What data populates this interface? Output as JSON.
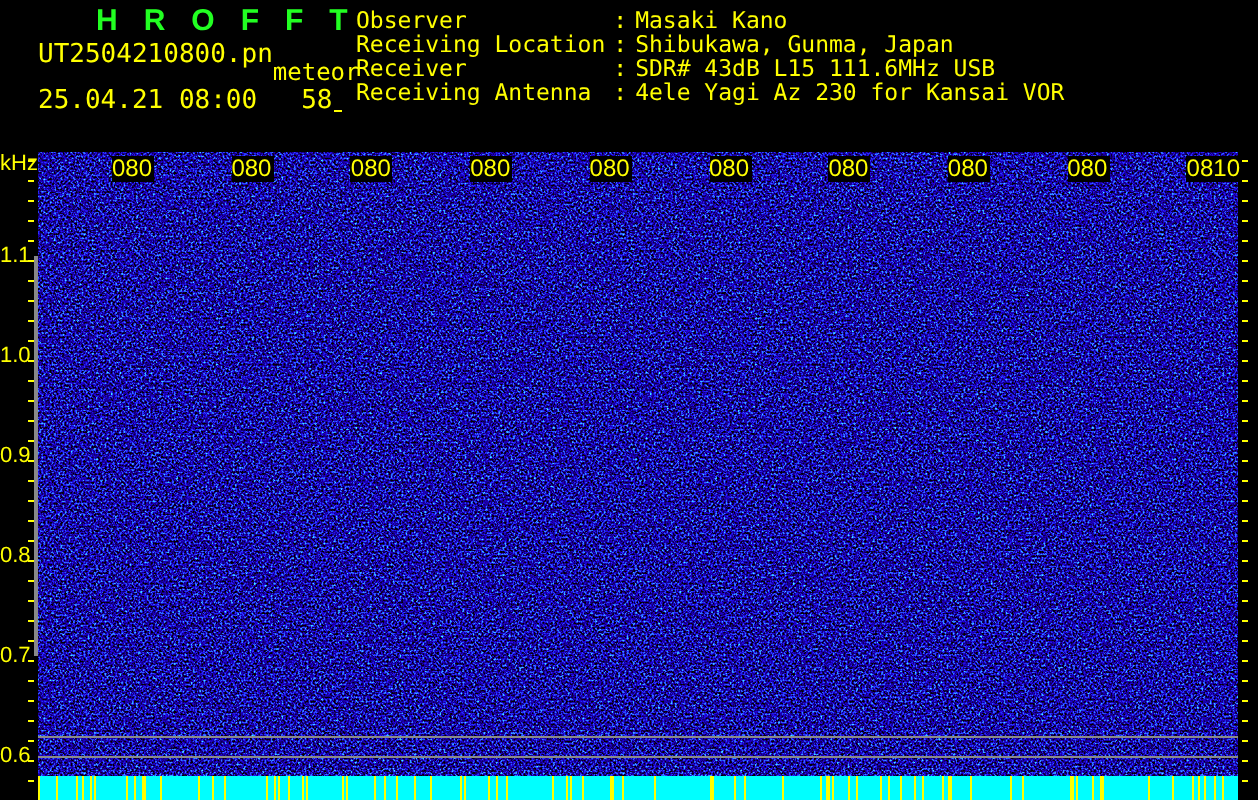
{
  "header": {
    "title": "HROFFT",
    "file_name": "UT2504210800.pn",
    "mode": "meteor",
    "timestamp": "25.04.21 08:00",
    "count": "58"
  },
  "info": [
    {
      "label": "Observer",
      "separator": ":",
      "value": "Masaki Kano"
    },
    {
      "label": "Receiving Location",
      "separator": ":",
      "value": "Shibukawa, Gunma, Japan"
    },
    {
      "label": "Receiver",
      "separator": ":",
      "value": "SDR# 43dB L15 111.6MHz USB"
    },
    {
      "label": "Receiving Antenna",
      "separator": ":",
      "value": "4ele Yagi Az 230 for Kansai VOR"
    }
  ],
  "spectrogram": {
    "y_unit": "kHz",
    "y_ticks": [
      "1.1",
      "1.0",
      "0.9",
      "0.8",
      "0.7",
      "0.6"
    ],
    "x_labels": [
      "080",
      "080",
      "080",
      "080",
      "080",
      "080",
      "080",
      "080",
      "080",
      "0810"
    ]
  }
}
